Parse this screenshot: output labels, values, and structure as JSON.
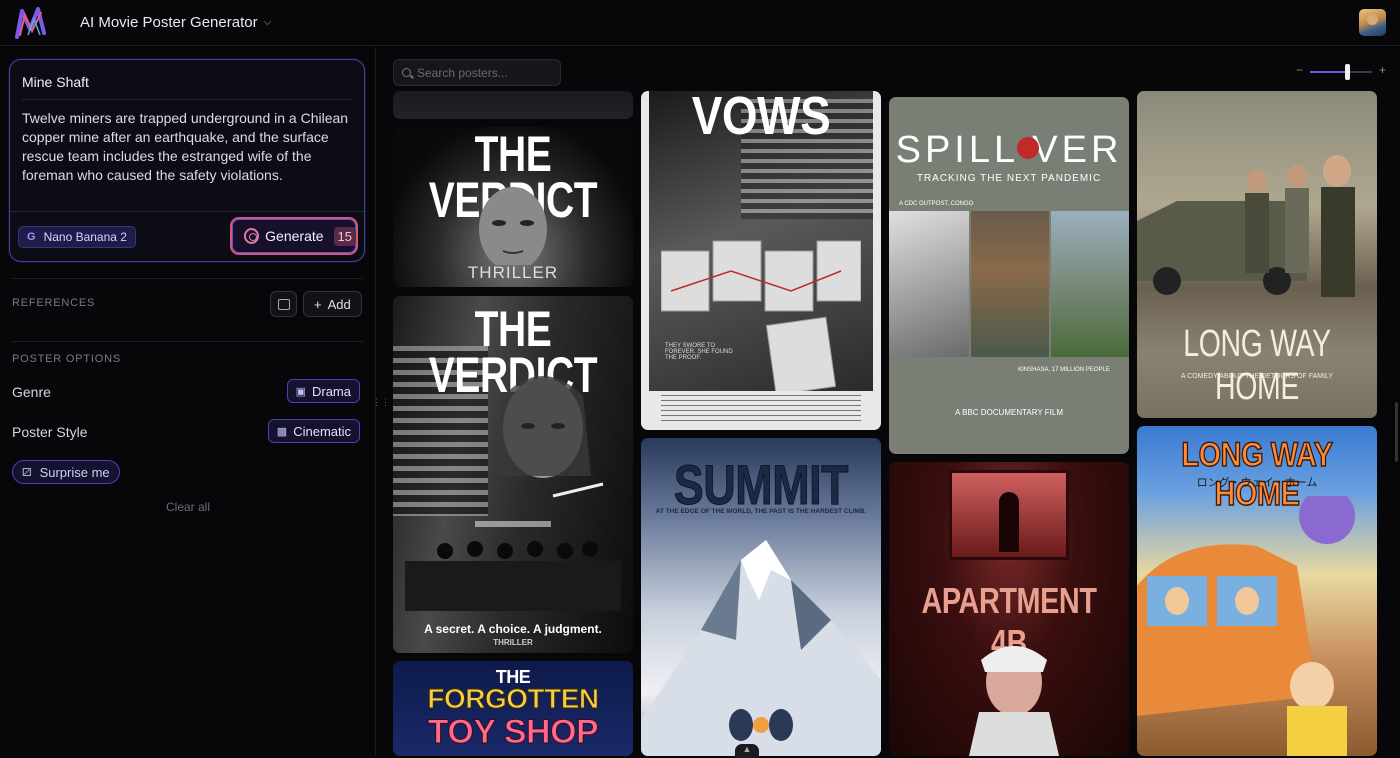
{
  "header": {
    "app_title": "AI Movie Poster Generator",
    "chevron_icon": "chevron-down-icon",
    "logo_icon": "brand-logo-icon",
    "avatar_icon": "user-avatar-icon"
  },
  "prompt": {
    "title": "Mine Shaft",
    "description": "Twelve miners are trapped underground in a Chilean copper mine after an earthquake, and the surface rescue team includes the estranged wife of the foreman who caused the safety violations.",
    "model_label": "Nano Banana 2",
    "model_icon": "G",
    "generate_label": "Generate",
    "generate_count": "15"
  },
  "references": {
    "label": "REFERENCES",
    "add_label": "Add",
    "add_icon": "+"
  },
  "poster_options": {
    "label": "POSTER OPTIONS",
    "genre_label": "Genre",
    "genre_value": "Drama",
    "style_label": "Poster Style",
    "style_value": "Cinematic",
    "surprise_label": "Surprise me",
    "clear_label": "Clear all"
  },
  "gallery": {
    "search_placeholder": "Search posters...",
    "zoom": {
      "minus": "−",
      "plus": "+",
      "level": 0.6
    },
    "posters": [
      {
        "id": "verdict-1",
        "title": "THE VERDICT",
        "tagline": "THRILLER"
      },
      {
        "id": "verdict-2",
        "title": "THE VERDICT",
        "tagline": "A secret. A choice. A judgment.",
        "footer": "THRILLER"
      },
      {
        "id": "forgotten",
        "title_top": "THE",
        "title_mid": "FORGOTTEN",
        "title_bot": "TOY SHOP"
      },
      {
        "id": "vows",
        "title": "VOWS",
        "tagline": "THEY SWORE TO FOREVER. SHE FOUND THE PROOF."
      },
      {
        "id": "summit",
        "title": "SUMMIT",
        "tagline": "AT THE EDGE OF THE WORLD, THE PAST IS THE HARDEST CLIMB."
      },
      {
        "id": "spillover",
        "title": "SPILL VER",
        "tagline": "TRACKING THE NEXT PANDEMIC",
        "note": "A CDC OUTPOST, CONGO",
        "caption": "KINSHASA, 17 MILLION PEOPLE",
        "footer": "A BBC DOCUMENTARY FILM"
      },
      {
        "id": "apartment",
        "title": "APARTMENT 4B"
      },
      {
        "id": "longway-1",
        "title": "LONG WAY HOME",
        "tagline": "A COMEDY ABOUT THE DETOURS OF FAMILY"
      },
      {
        "id": "longway-2",
        "title": "LONG WAY HOME",
        "tagline": "ロング・ウェイ・ホーム"
      }
    ]
  },
  "colors": {
    "accent": "#4a40b8",
    "generate_border": "#d05a7a",
    "background": "#07070a"
  }
}
